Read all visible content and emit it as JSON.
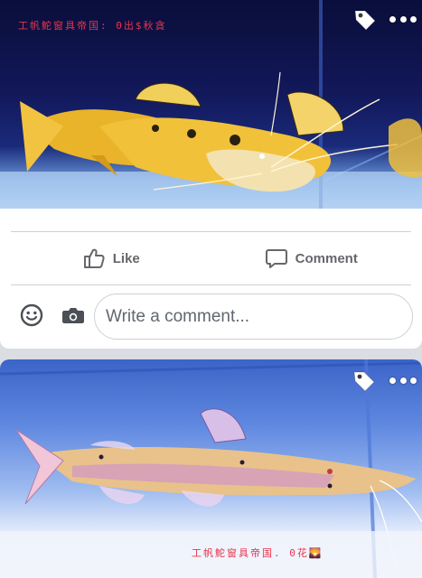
{
  "posts": [
    {
      "photo_alt": "",
      "watermark": "工帆鮀窗具帝国: 0出$秋貪",
      "tag_icon": "tag-icon",
      "more_icon": "more-options-icon",
      "actions": {
        "like_label": "Like",
        "comment_label": "Comment"
      },
      "comment_box": {
        "placeholder": "Write a comment...",
        "value": ""
      }
    },
    {
      "watermark": "工帆鮀窗具帝国. 0花🌄",
      "tag_icon": "tag-icon",
      "more_icon": "more-options-icon"
    }
  ],
  "colors": {
    "page_bg": "#dadde1",
    "card_bg": "#ffffff",
    "action_text": "#65676b",
    "divider": "#ced0d4",
    "watermark_red": "#e8344a"
  }
}
